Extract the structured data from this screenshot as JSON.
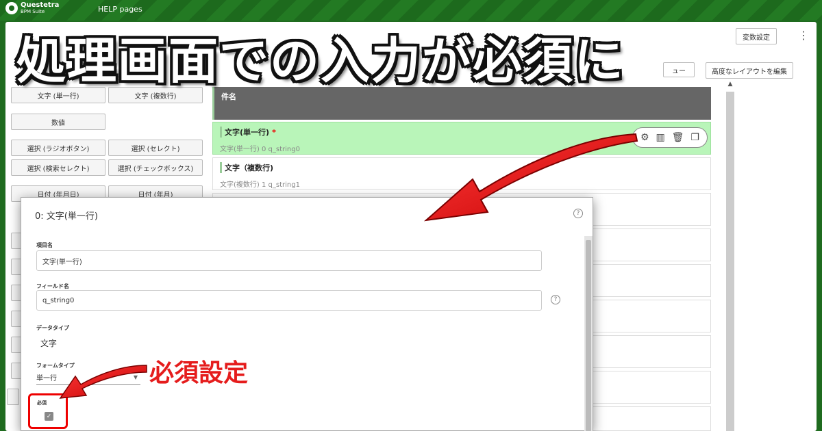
{
  "header": {
    "logo_name": "Questetra",
    "logo_sub": "BPM Suite",
    "help_link": "HELP pages"
  },
  "toolbar": {
    "variables_button": "変数設定",
    "advanced_layout_button": "高度なレイアウトを編集",
    "menu_button_partial": "ュー"
  },
  "overlay": {
    "title": "処理画面での入力が必須に",
    "annotation": "必須設定"
  },
  "palette": {
    "items": [
      "文字 (単一行)",
      "文字 (複数行)",
      "数値",
      "選択 (ラジオボタン)",
      "選択 (セレクト)",
      "選択 (検索セレクト)",
      "選択 (チェックボックス)",
      "日付 (年月日)",
      "日付 (年月)"
    ]
  },
  "form": {
    "header_label": "件名",
    "items": [
      {
        "title": "文字(単一行)",
        "required_mark": "*",
        "sub": "文字(単一行) 0 q_string0"
      },
      {
        "title": "文字（複数行)",
        "sub": "文字(複数行) 1 q_string1"
      }
    ]
  },
  "dialog": {
    "title": "0: 文字(単一行)",
    "help_glyph": "?",
    "item_name_label": "項目名",
    "item_name_value": "文字(単一行)",
    "field_name_label": "フィールド名",
    "field_name_value": "q_string0",
    "data_type_label": "データタイプ",
    "data_type_value": "文字",
    "form_type_label": "フォームタイプ",
    "form_type_value": "単一行",
    "required_label": "必須",
    "required_checked": true
  },
  "colors": {
    "brand_green": "#1f6b1f",
    "selected_row": "#b9f5b9",
    "accent_red": "#e51c1c"
  }
}
